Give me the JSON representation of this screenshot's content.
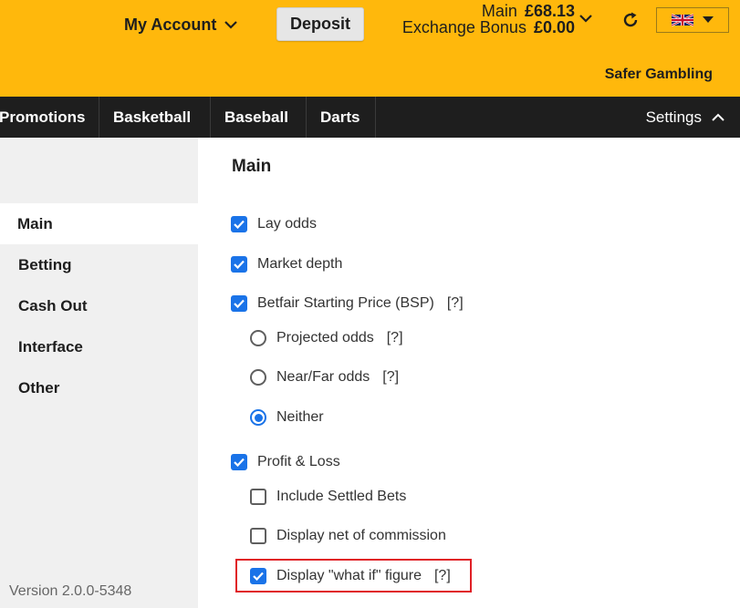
{
  "header": {
    "my_account": "My Account",
    "deposit": "Deposit",
    "main_label": "Main",
    "main_amount": "£68.13",
    "bonus_label": "Exchange Bonus",
    "bonus_amount": "£0.00",
    "safer_gambling": "Safer Gambling",
    "language_flag": "uk-flag-icon",
    "brand_color": "#ffb80c"
  },
  "nav": {
    "items": [
      "Promotions",
      "Basketball",
      "Baseball",
      "Darts"
    ],
    "settings": "Settings"
  },
  "sidebar": {
    "items": [
      {
        "label": "Main",
        "active": true
      },
      {
        "label": "Betting",
        "active": false
      },
      {
        "label": "Cash Out",
        "active": false
      },
      {
        "label": "Interface",
        "active": false
      },
      {
        "label": "Other",
        "active": false
      }
    ],
    "version": "Version 2.0.0-5348"
  },
  "main": {
    "title": "Main",
    "help": "[?]",
    "options": {
      "lay_odds": {
        "label": "Lay odds",
        "checked": true
      },
      "market_depth": {
        "label": "Market depth",
        "checked": true
      },
      "bsp": {
        "label": "Betfair Starting Price (BSP)",
        "checked": true
      },
      "projected": {
        "label": "Projected odds",
        "selected": false
      },
      "near_far": {
        "label": "Near/Far odds",
        "selected": false
      },
      "neither": {
        "label": "Neither",
        "selected": true
      },
      "pnl": {
        "label": "Profit & Loss",
        "checked": true
      },
      "settled": {
        "label": "Include Settled Bets",
        "checked": false
      },
      "net_commission": {
        "label": "Display net of commission",
        "checked": false
      },
      "what_if": {
        "label": "Display \"what if\" figure",
        "checked": true
      }
    }
  },
  "colors": {
    "checkbox": "#1a73e8",
    "highlight": "#e01f26",
    "nav_bg": "#1e1e1e"
  }
}
